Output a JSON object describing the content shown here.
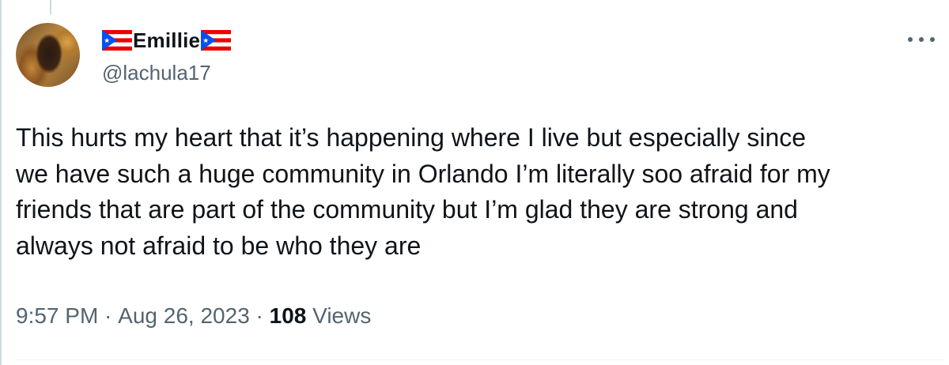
{
  "tweet": {
    "author": {
      "display_name": "Emillie",
      "handle": "@lachula17",
      "name_flag": "puerto-rico-flag"
    },
    "text": "This hurts my heart that it’s happening where I live but especially since\nwe have such a huge community in Orlando I’m literally soo afraid for my\nfriends that are part of the community but I’m glad they are strong and\nalways not afraid to be who they are",
    "time": "9:57 PM",
    "separator": " · ",
    "date": "Aug 26, 2023",
    "views_count": "108",
    "views_label": " Views",
    "more_icon": "more-dots-icon"
  },
  "colors": {
    "text": "#0f1419",
    "secondary": "#536471",
    "flag_blue": "#0050f0",
    "flag_red": "#ed0000"
  }
}
